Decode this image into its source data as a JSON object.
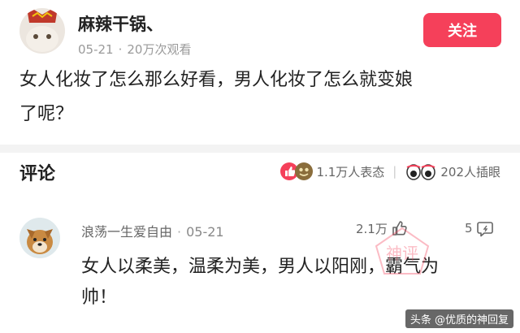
{
  "post": {
    "author": "麻辣干锅、",
    "date": "05-21",
    "views": "20万次观看",
    "follow_label": "关注",
    "content_line1": "女人化妆了怎么那么好看，男人化妆了怎么就变娘",
    "content_line2": "了呢？"
  },
  "comments_header": {
    "title": "评论",
    "reactions": "1.1万人表态",
    "illustrations": "202人插眼"
  },
  "comment": {
    "author": "浪荡一生爱自由",
    "time": "05-21",
    "likes": "2.1万",
    "replies": "5",
    "text_line1": "女人以柔美，温柔为美，男人以阳刚，霸气为",
    "text_line2": "帅！"
  },
  "stamp_text": "神评",
  "watermark": "头条 @优质的神回复",
  "colors": {
    "accent": "#f5405a",
    "meta_gray": "#9a9a9a"
  }
}
